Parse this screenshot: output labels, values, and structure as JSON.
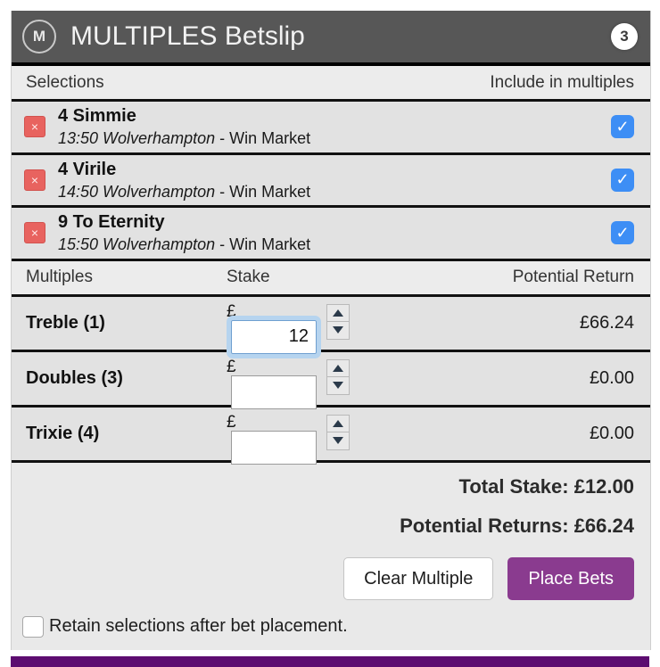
{
  "header": {
    "logo": "M",
    "title": "MULTIPLES Betslip",
    "count": "3"
  },
  "columns": {
    "selections": "Selections",
    "include": "Include in multiples",
    "multiples": "Multiples",
    "stake": "Stake",
    "potential_return": "Potential Return"
  },
  "selections": [
    {
      "remove_icon": "×",
      "name": "4 Simmie",
      "event": "13:50 Wolverhampton",
      "separator": " - ",
      "market": "Win Market",
      "check_icon": "✓"
    },
    {
      "remove_icon": "×",
      "name": "4 Virile",
      "event": "14:50 Wolverhampton",
      "separator": " - ",
      "market": "Win Market",
      "check_icon": "✓"
    },
    {
      "remove_icon": "×",
      "name": "9 To Eternity",
      "event": "15:50 Wolverhampton",
      "separator": " - ",
      "market": "Win Market",
      "check_icon": "✓"
    }
  ],
  "multiples": [
    {
      "name": "Treble (1)",
      "currency": "£",
      "stake": "12",
      "return": "£66.24"
    },
    {
      "name": "Doubles (3)",
      "currency": "£",
      "stake": "",
      "return": "£0.00"
    },
    {
      "name": "Trixie (4)",
      "currency": "£",
      "stake": "",
      "return": "£0.00"
    }
  ],
  "totals": {
    "total_stake": "Total Stake: £12.00",
    "potential_returns": "Potential Returns: £66.24"
  },
  "buttons": {
    "clear": "Clear Multiple",
    "place": "Place Bets"
  },
  "retain": {
    "label": "Retain selections after bet placement.",
    "checked": false
  },
  "colors": {
    "header_bg": "#575757",
    "accent_purple": "#8a3b8f",
    "strip_purple": "#5d0d70",
    "checkbox_blue": "#3d8ef5",
    "delete_red": "#e8635f"
  }
}
